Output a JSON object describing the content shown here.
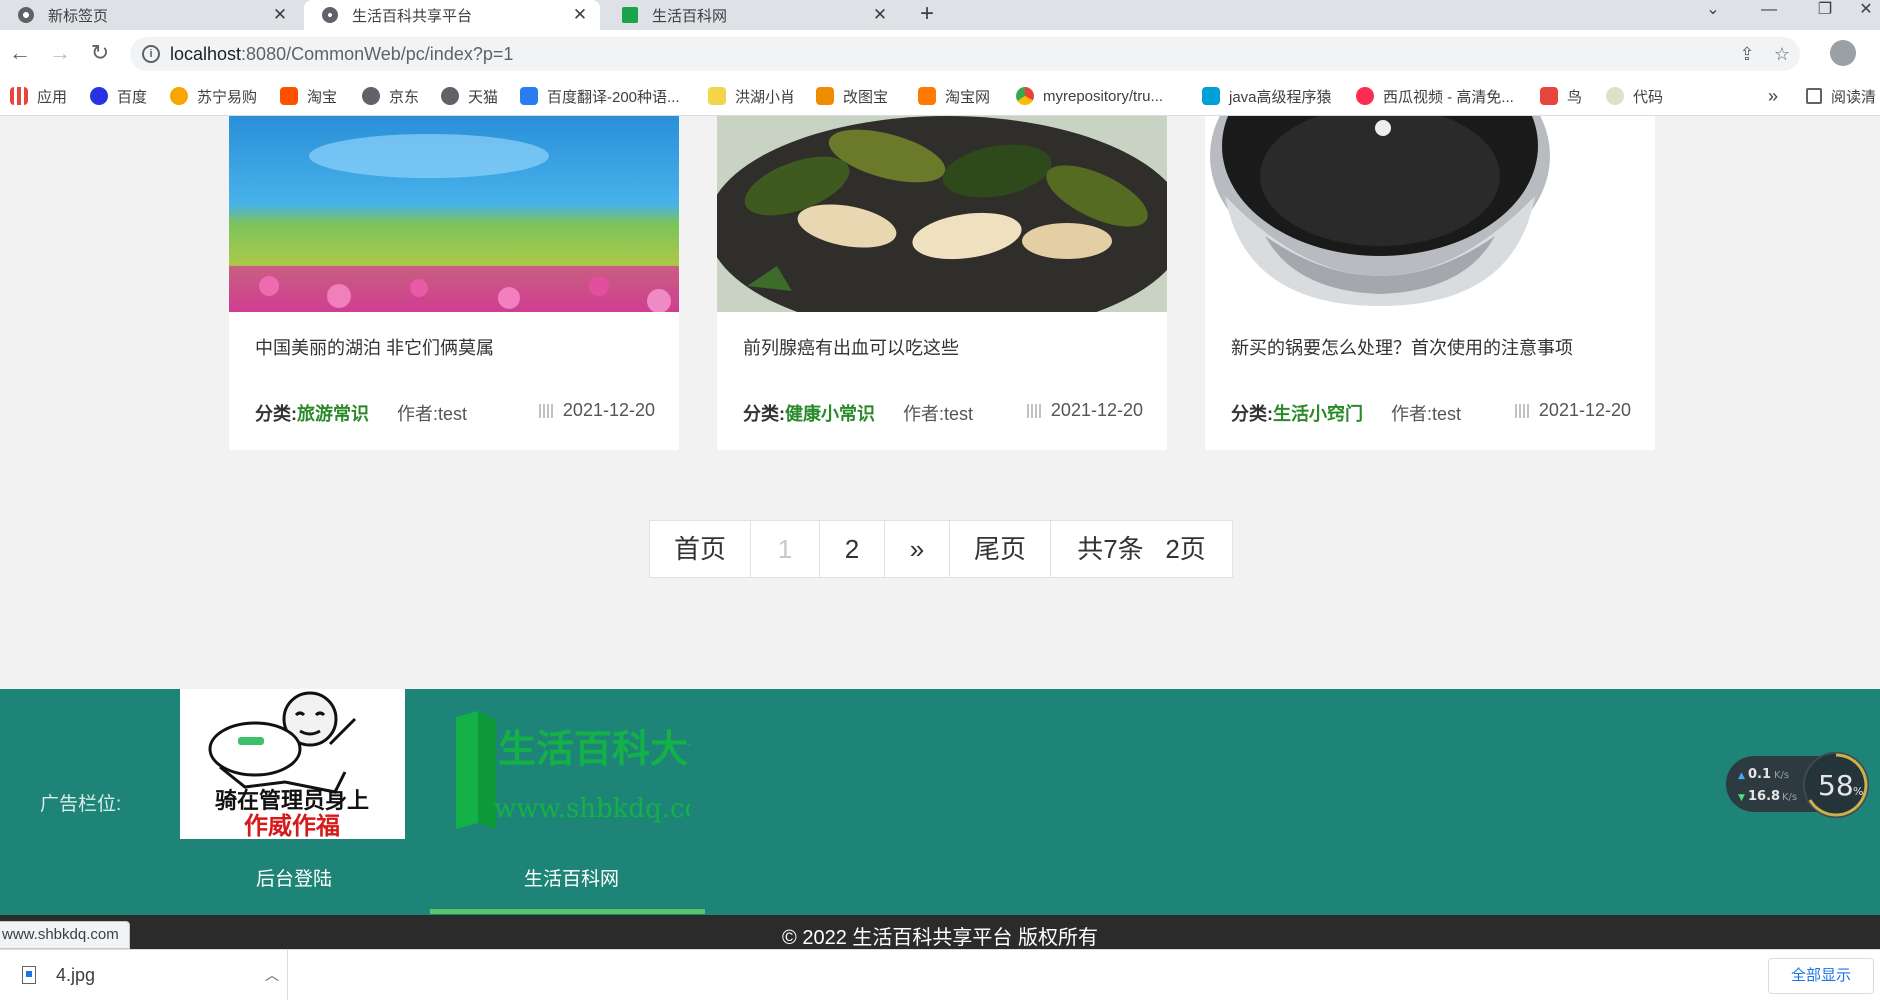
{
  "browser": {
    "tabs": [
      {
        "title": "新标签页",
        "active": false
      },
      {
        "title": "生活百科共享平台",
        "active": true
      },
      {
        "title": "生活百科网",
        "active": false
      }
    ],
    "url_host": "localhost",
    "url_path": ":8080/CommonWeb/pc/index?p=1",
    "bookmarks": [
      "应用",
      "百度",
      "苏宁易购",
      "淘宝",
      "京东",
      "天猫",
      "百度翻译-200种语...",
      "洪湖小肖",
      "改图宝",
      "淘宝网",
      "myrepository/tru...",
      "java高级程序猿",
      "西瓜视频 - 高清免...",
      "鸟",
      "代码"
    ],
    "bookmarks_overflow": "»",
    "reading_list": "阅读清"
  },
  "articles": [
    {
      "title": "中国美丽的湖泊 非它们俩莫属",
      "category_label": "分类:",
      "category": "旅游常识",
      "author": "作者:test",
      "date": "2021-12-20"
    },
    {
      "title": "前列腺癌有出血可以吃这些",
      "category_label": "分类:",
      "category": "健康小常识",
      "author": "作者:test",
      "date": "2021-12-20"
    },
    {
      "title": "新买的锅要怎么处理？首次使用的注意事项",
      "category_label": "分类:",
      "category": "生活小窍门",
      "author": "作者:test",
      "date": "2021-12-20"
    }
  ],
  "pagination": {
    "first": "首页",
    "current": "1",
    "page2": "2",
    "next": "»",
    "last": "尾页",
    "total_items": "共7条",
    "total_pages": "2页"
  },
  "footer": {
    "ad_label": "广告栏位:",
    "ad1_line1": "骑在管理员身上",
    "ad1_line2": "作威作福",
    "ad2_title": "生活百科大全",
    "ad2_url": "www.shbkdq.com",
    "links": [
      "后台登陆",
      "生活百科网"
    ],
    "copyright": "© 2022 生活百科共享平台 版权所有"
  },
  "net_monitor": {
    "up": "0.1",
    "down": "16.8",
    "unit": "K/s",
    "percent": "58",
    "percent_unit": "%"
  },
  "status_url": "www.shbkdq.com",
  "downloads": {
    "file": "4.jpg",
    "show_all": "全部显示"
  },
  "colors": {
    "footer_bg": "#1e8478",
    "category_green": "#2a8a2a",
    "accent_underline": "#5cc46a"
  }
}
